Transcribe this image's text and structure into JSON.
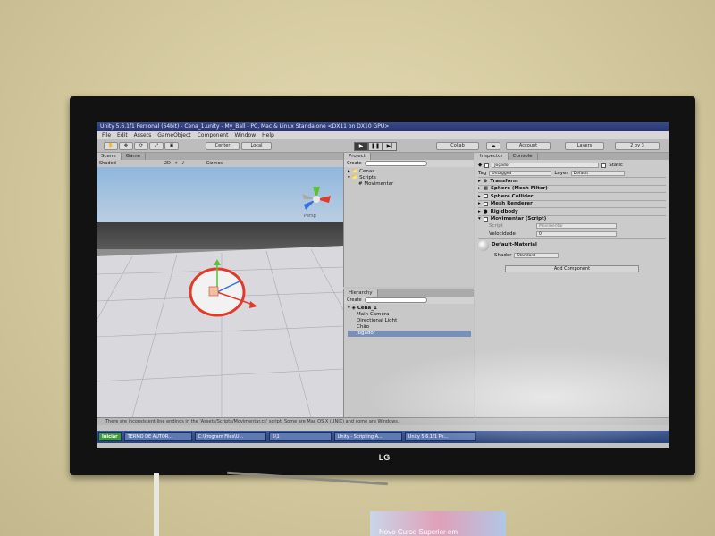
{
  "window": {
    "title": "Unity 5.6.1f1 Personal (64bit) - Cena_1.unity - My_Ball - PC, Mac & Linux Standalone <DX11 on DX10 GPU>"
  },
  "menu": [
    "File",
    "Edit",
    "Assets",
    "GameObject",
    "Component",
    "Window",
    "Help"
  ],
  "toolbar": {
    "pivot_label": "Center",
    "space_label": "Local",
    "collab_label": "Collab",
    "account_label": "Account",
    "layers_label": "Layers",
    "layout_label": "2 by 3"
  },
  "scene": {
    "tabs": [
      "Scene",
      "Game"
    ],
    "shading_mode": "Shaded",
    "mode_2d": "2D",
    "gizmos_label": "Gizmos",
    "persp_label": "Persp"
  },
  "project": {
    "tab": "Project",
    "create_label": "Create",
    "items": [
      "Cenas",
      "Scripts",
      "Movimentar"
    ]
  },
  "hierarchy": {
    "tab": "Hierarchy",
    "create_label": "Create",
    "scene_name": "Cena_1",
    "items": [
      "Main Camera",
      "Directional Light",
      "Chão",
      "Jogador"
    ]
  },
  "inspector": {
    "tabs": [
      "Inspector",
      "Console"
    ],
    "object_name": "Jogador",
    "static_label": "Static",
    "tag_label": "Tag",
    "tag_value": "Untagged",
    "layer_label": "Layer",
    "layer_value": "Default",
    "components": [
      "Transform",
      "Sphere (Mesh Filter)",
      "Sphere Collider",
      "Mesh Renderer",
      "Rigidbody",
      "Movimentar (Script)"
    ],
    "script_field_label": "Script",
    "script_field_value": "Movimentar",
    "velocidade_label": "Velocidade",
    "velocidade_value": "0",
    "material_name": "Default-Material",
    "shader_label": "Shader",
    "shader_value": "Standard",
    "add_component_label": "Add Component"
  },
  "console_message": "There are inconsistent line endings in the 'Assets/Scripts/Movimentar.cs' script. Some are Mac OS X (UNIX) and some are Windows.",
  "taskbar": {
    "items": [
      "Iniciar",
      "TERMO DE AUTOR...",
      "C:\\Program Files\\U...",
      "5\\1",
      "Unity - Scripting A...",
      "Unity 5.6.1f1 Pe..."
    ]
  },
  "tv_brand": "LG",
  "poster_text": "Novo Curso Superior em",
  "colors": {
    "title_bar": "#273670",
    "selection": "#7a8fb8",
    "gizmo_x": "#e03a2a",
    "gizmo_y": "#5fbf3a",
    "gizmo_z": "#3a6fe0"
  }
}
